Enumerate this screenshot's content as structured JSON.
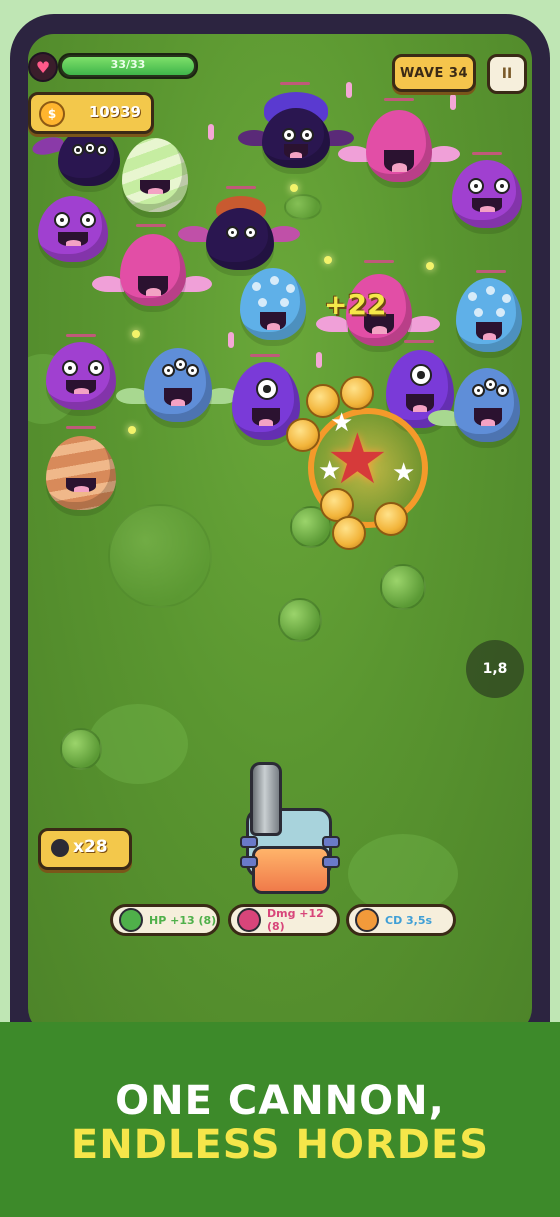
{
  "hud": {
    "hp_text": "33/33",
    "hp_fraction": 1.0,
    "coins": "10939",
    "coin_symbol": "$",
    "wave_label": "WAVE 34",
    "pause_symbol": "II"
  },
  "battle": {
    "damage_popup": "+22",
    "cooldown_timer": "1,8",
    "ammo_count": "x28"
  },
  "buffs": [
    {
      "label": "HP +13 (8)",
      "color": "#4fb04a",
      "icon": "shield-icon"
    },
    {
      "label": "Dmg +12 (8)",
      "color": "#d8457a",
      "icon": "damage-icon"
    },
    {
      "label": "CD 3,5s",
      "color": "#3f9fd6",
      "icon": "fire-icon"
    }
  ],
  "banner": {
    "line1": "ONE CANNON,",
    "line2": "ENDLESS HORDES"
  },
  "colors": {
    "field_green": "#5a9630",
    "banner_green": "#3d8a2a",
    "tagline_yellow": "#f5e64a",
    "ui_gold": "#f3c84b"
  }
}
